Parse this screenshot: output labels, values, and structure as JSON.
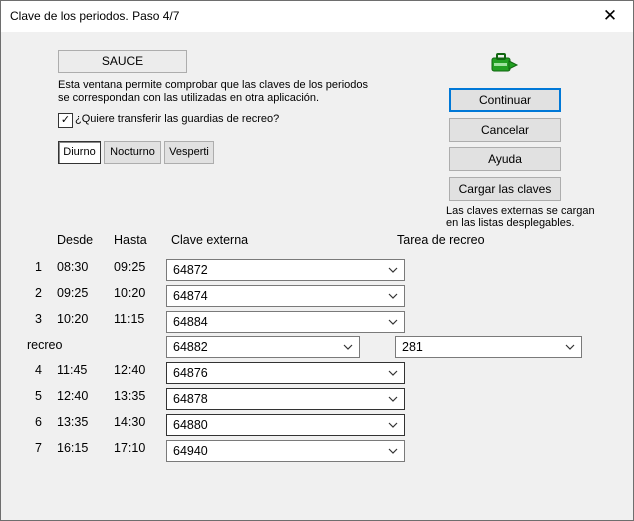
{
  "window": {
    "title": "Clave de los periodos. Paso 4/7"
  },
  "school": "SAUCE",
  "info_line1": "Esta ventana permite comprobar que las claves de los periodos",
  "info_line2": "se correspondan con las utilizadas en otra aplicación.",
  "checkbox": {
    "label": "¿Quiere transferir las guardias de recreo?",
    "checked": true
  },
  "shifts": [
    "Diurno",
    "Nocturno",
    "Vesperti"
  ],
  "buttons": {
    "continue": "Continuar",
    "cancel": "Cancelar",
    "help": "Ayuda",
    "load": "Cargar las claves"
  },
  "note_line1": "Las claves externas se cargan",
  "note_line2": "en las listas desplegables.",
  "headers": {
    "desde": "Desde",
    "hasta": "Hasta",
    "clave": "Clave externa",
    "tarea": "Tarea de recreo"
  },
  "periods": [
    {
      "num": "1",
      "desde": "08:30",
      "hasta": "09:25",
      "clave": "64872"
    },
    {
      "num": "2",
      "desde": "09:25",
      "hasta": "10:20",
      "clave": "64874"
    },
    {
      "num": "3",
      "desde": "10:20",
      "hasta": "11:15",
      "clave": "64884"
    },
    {
      "label": "recreo",
      "clave": "64882",
      "tarea": "281"
    },
    {
      "num": "4",
      "desde": "11:45",
      "hasta": "12:40",
      "clave": "64876"
    },
    {
      "num": "5",
      "desde": "12:40",
      "hasta": "13:35",
      "clave": "64878"
    },
    {
      "num": "6",
      "desde": "13:35",
      "hasta": "14:30",
      "clave": "64880"
    },
    {
      "num": "7",
      "desde": "16:15",
      "hasta": "17:10",
      "clave": "64940"
    }
  ],
  "colors": {
    "accent": "#0078d7",
    "icon": "#22a022"
  }
}
